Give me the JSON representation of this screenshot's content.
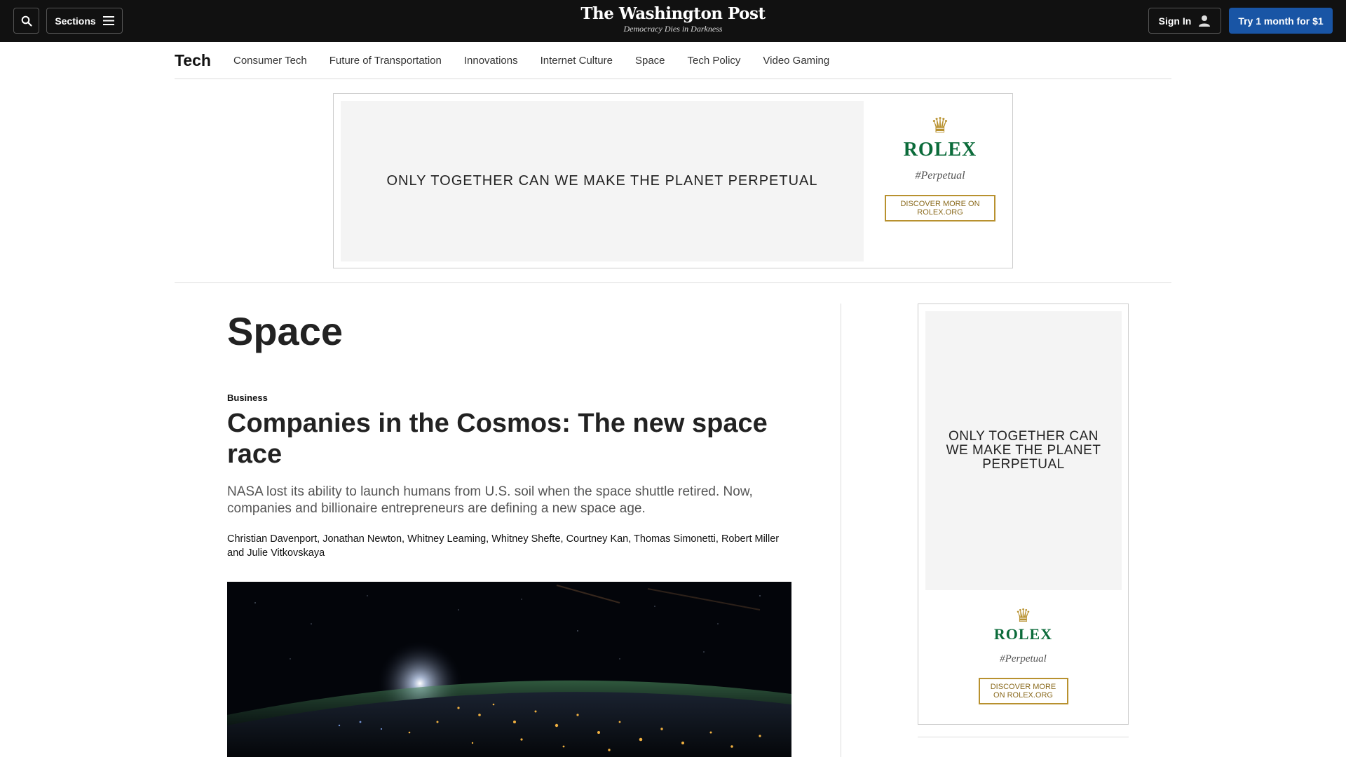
{
  "header": {
    "sections_label": "Sections",
    "logo_text": "The Washington Post",
    "tagline": "Democracy Dies in Darkness",
    "signin_label": "Sign In",
    "subscribe_label": "Try 1 month for $1"
  },
  "subnav": {
    "title": "Tech",
    "items": [
      "Consumer Tech",
      "Future of Transportation",
      "Innovations",
      "Internet Culture",
      "Space",
      "Tech Policy",
      "Video Gaming"
    ]
  },
  "ad_top": {
    "headline": "ONLY TOGETHER CAN WE MAKE THE PLANET PERPETUAL",
    "brand": "ROLEX",
    "hashtag": "#Perpetual",
    "cta": "DISCOVER MORE ON ROLEX.ORG"
  },
  "main": {
    "page_title": "Space",
    "kicker": "Business",
    "headline": "Companies in the Cosmos: The new space race",
    "dek": "NASA lost its ability to launch humans from U.S. soil when the space shuttle retired. Now, companies and billionaire entrepreneurs are defining a new space age.",
    "byline": "Christian Davenport, Jonathan Newton, Whitney Leaming, Whitney Shefte, Courtney Kan, Thomas Simonetti, Robert Miller and Julie Vitkovskaya"
  },
  "ad_right": {
    "headline": "ONLY TOGETHER CAN WE MAKE THE PLANET PERPETUAL",
    "brand": "ROLEX",
    "hashtag": "#Perpetual",
    "cta": "DISCOVER MORE ON ROLEX.ORG"
  },
  "icons": [
    "search-icon",
    "menu-icon",
    "user-icon",
    "crown-icon"
  ],
  "colors": {
    "topbar": "#111111",
    "subscribe": "#1955a5",
    "rolex_green": "#0b6b3a",
    "rolex_gold": "#b8912f"
  }
}
